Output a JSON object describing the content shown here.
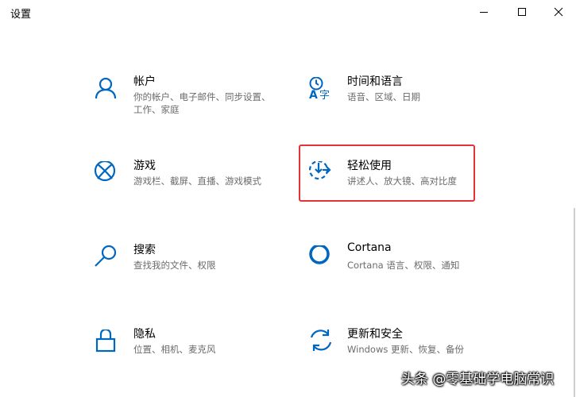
{
  "window": {
    "title": "设置",
    "controls": [
      "minimize",
      "maximize",
      "close"
    ]
  },
  "tiles": [
    {
      "title": "帐户",
      "desc": "你的帐户、电子邮件、同步设置、工作、家庭",
      "icon": "person-icon"
    },
    {
      "title": "时间和语言",
      "desc": "语音、区域、日期",
      "icon": "time-language-icon"
    },
    {
      "title": "游戏",
      "desc": "游戏栏、截屏、直播、游戏模式",
      "icon": "xbox-icon"
    },
    {
      "title": "轻松使用",
      "desc": "讲述人、放大镜、高对比度",
      "icon": "ease-of-access-icon"
    },
    {
      "title": "搜索",
      "desc": "查找我的文件、权限",
      "icon": "search-icon"
    },
    {
      "title": "Cortana",
      "desc": "Cortana 语言、权限、通知",
      "icon": "cortana-icon"
    },
    {
      "title": "隐私",
      "desc": "位置、相机、麦克风",
      "icon": "lock-icon"
    },
    {
      "title": "更新和安全",
      "desc": "Windows 更新、恢复、备份",
      "icon": "update-icon"
    }
  ],
  "watermark": "头条 @零基础学电脑常识",
  "colors": {
    "accent": "#0067c0",
    "highlight": "#e53333",
    "desc": "#6b6b6b"
  }
}
